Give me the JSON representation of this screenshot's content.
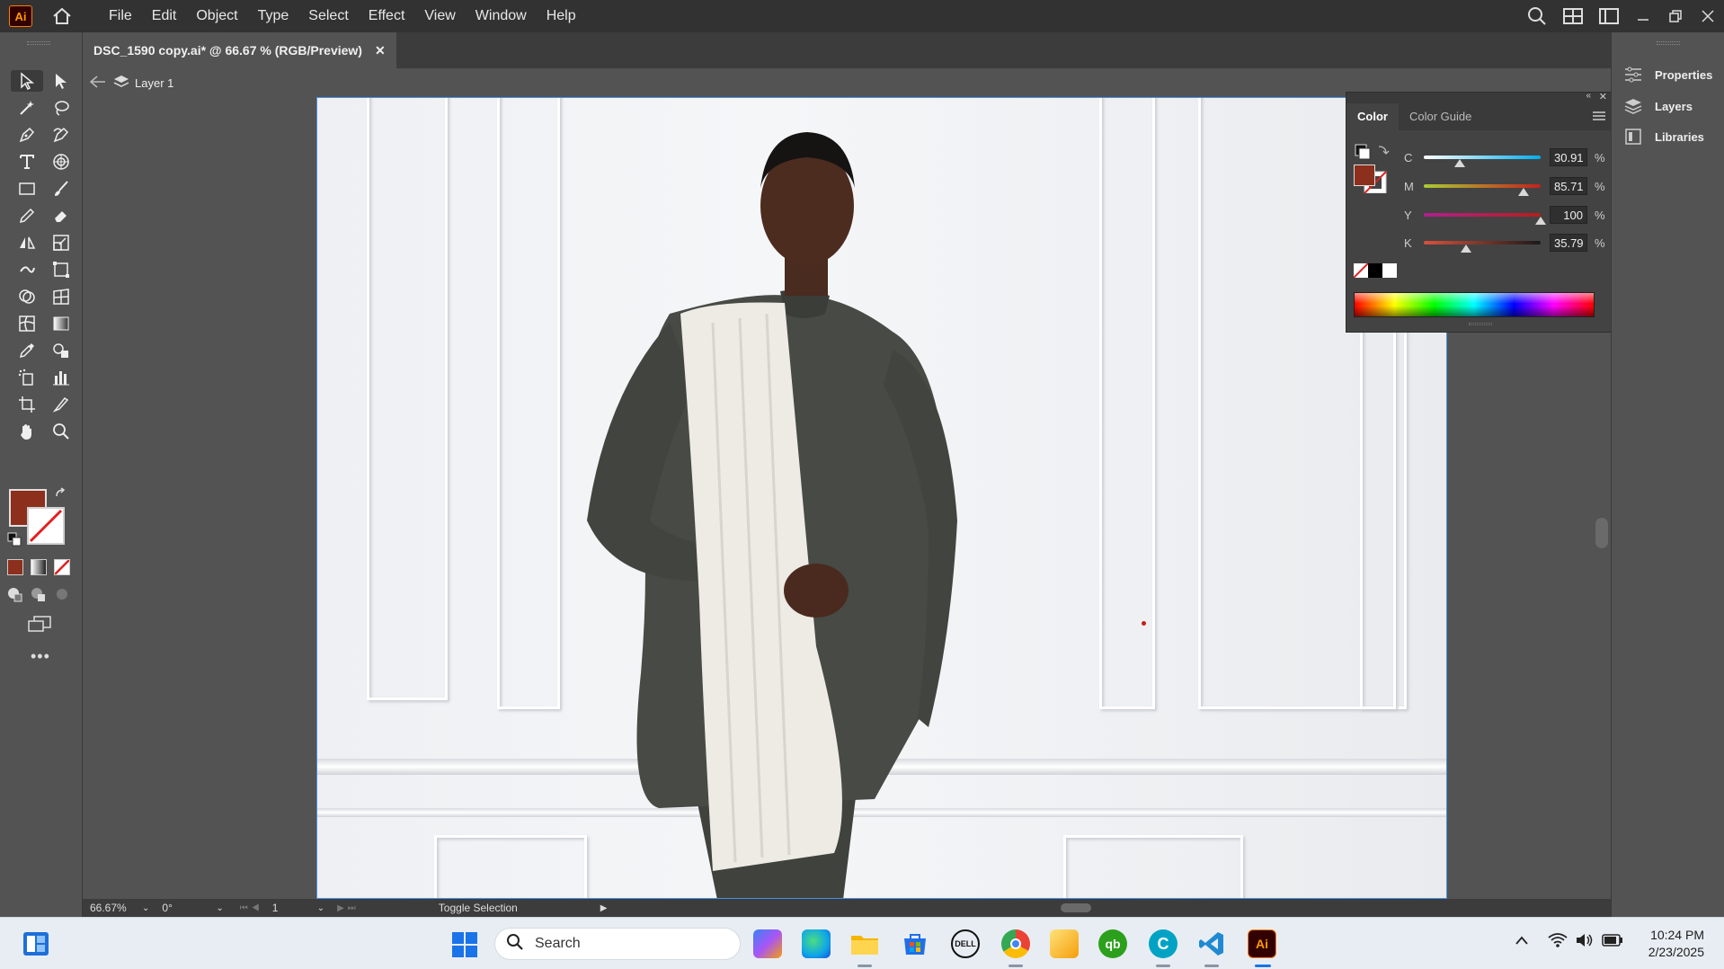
{
  "app": {
    "logo_text": "Ai",
    "menu": [
      "File",
      "Edit",
      "Object",
      "Type",
      "Select",
      "Effect",
      "View",
      "Window",
      "Help"
    ]
  },
  "document": {
    "tab_title": "DSC_1590 copy.ai* @ 66.67 % (RGB/Preview)",
    "close_glyph": "✕",
    "layer_name": "Layer 1"
  },
  "color_panel": {
    "tabs": [
      "Color",
      "Color Guide"
    ],
    "channels": [
      {
        "label": "C",
        "value": "30.91",
        "level": 0.3091,
        "gradient": "linear-gradient(90deg,#ffffff,#00aeef)"
      },
      {
        "label": "M",
        "value": "85.71",
        "level": 0.8571,
        "gradient": "linear-gradient(90deg,#aacc33,#c4201f)"
      },
      {
        "label": "Y",
        "value": "100",
        "level": 1.0,
        "gradient": "linear-gradient(90deg,#b0208e,#b4201c)"
      },
      {
        "label": "K",
        "value": "35.79",
        "level": 0.3579,
        "gradient": "linear-gradient(90deg,#d9513c,#1a1a1a)"
      }
    ],
    "percent": "%",
    "fill_color": "#8c2f1c"
  },
  "dock": {
    "items": [
      "Properties",
      "Layers",
      "Libraries"
    ]
  },
  "status": {
    "zoom": "66.67%",
    "rotation": "0°",
    "artboard_num": "1",
    "mode": "Toggle Selection"
  },
  "taskbar": {
    "search_placeholder": "Search",
    "time": "10:24 PM",
    "date": "2/23/2025",
    "dell_label": "DELL",
    "qb_label": "qb",
    "ai_label": "Ai"
  },
  "colors": {
    "accent_blue": "#4a90e2",
    "fill": "#8c2f1c"
  }
}
